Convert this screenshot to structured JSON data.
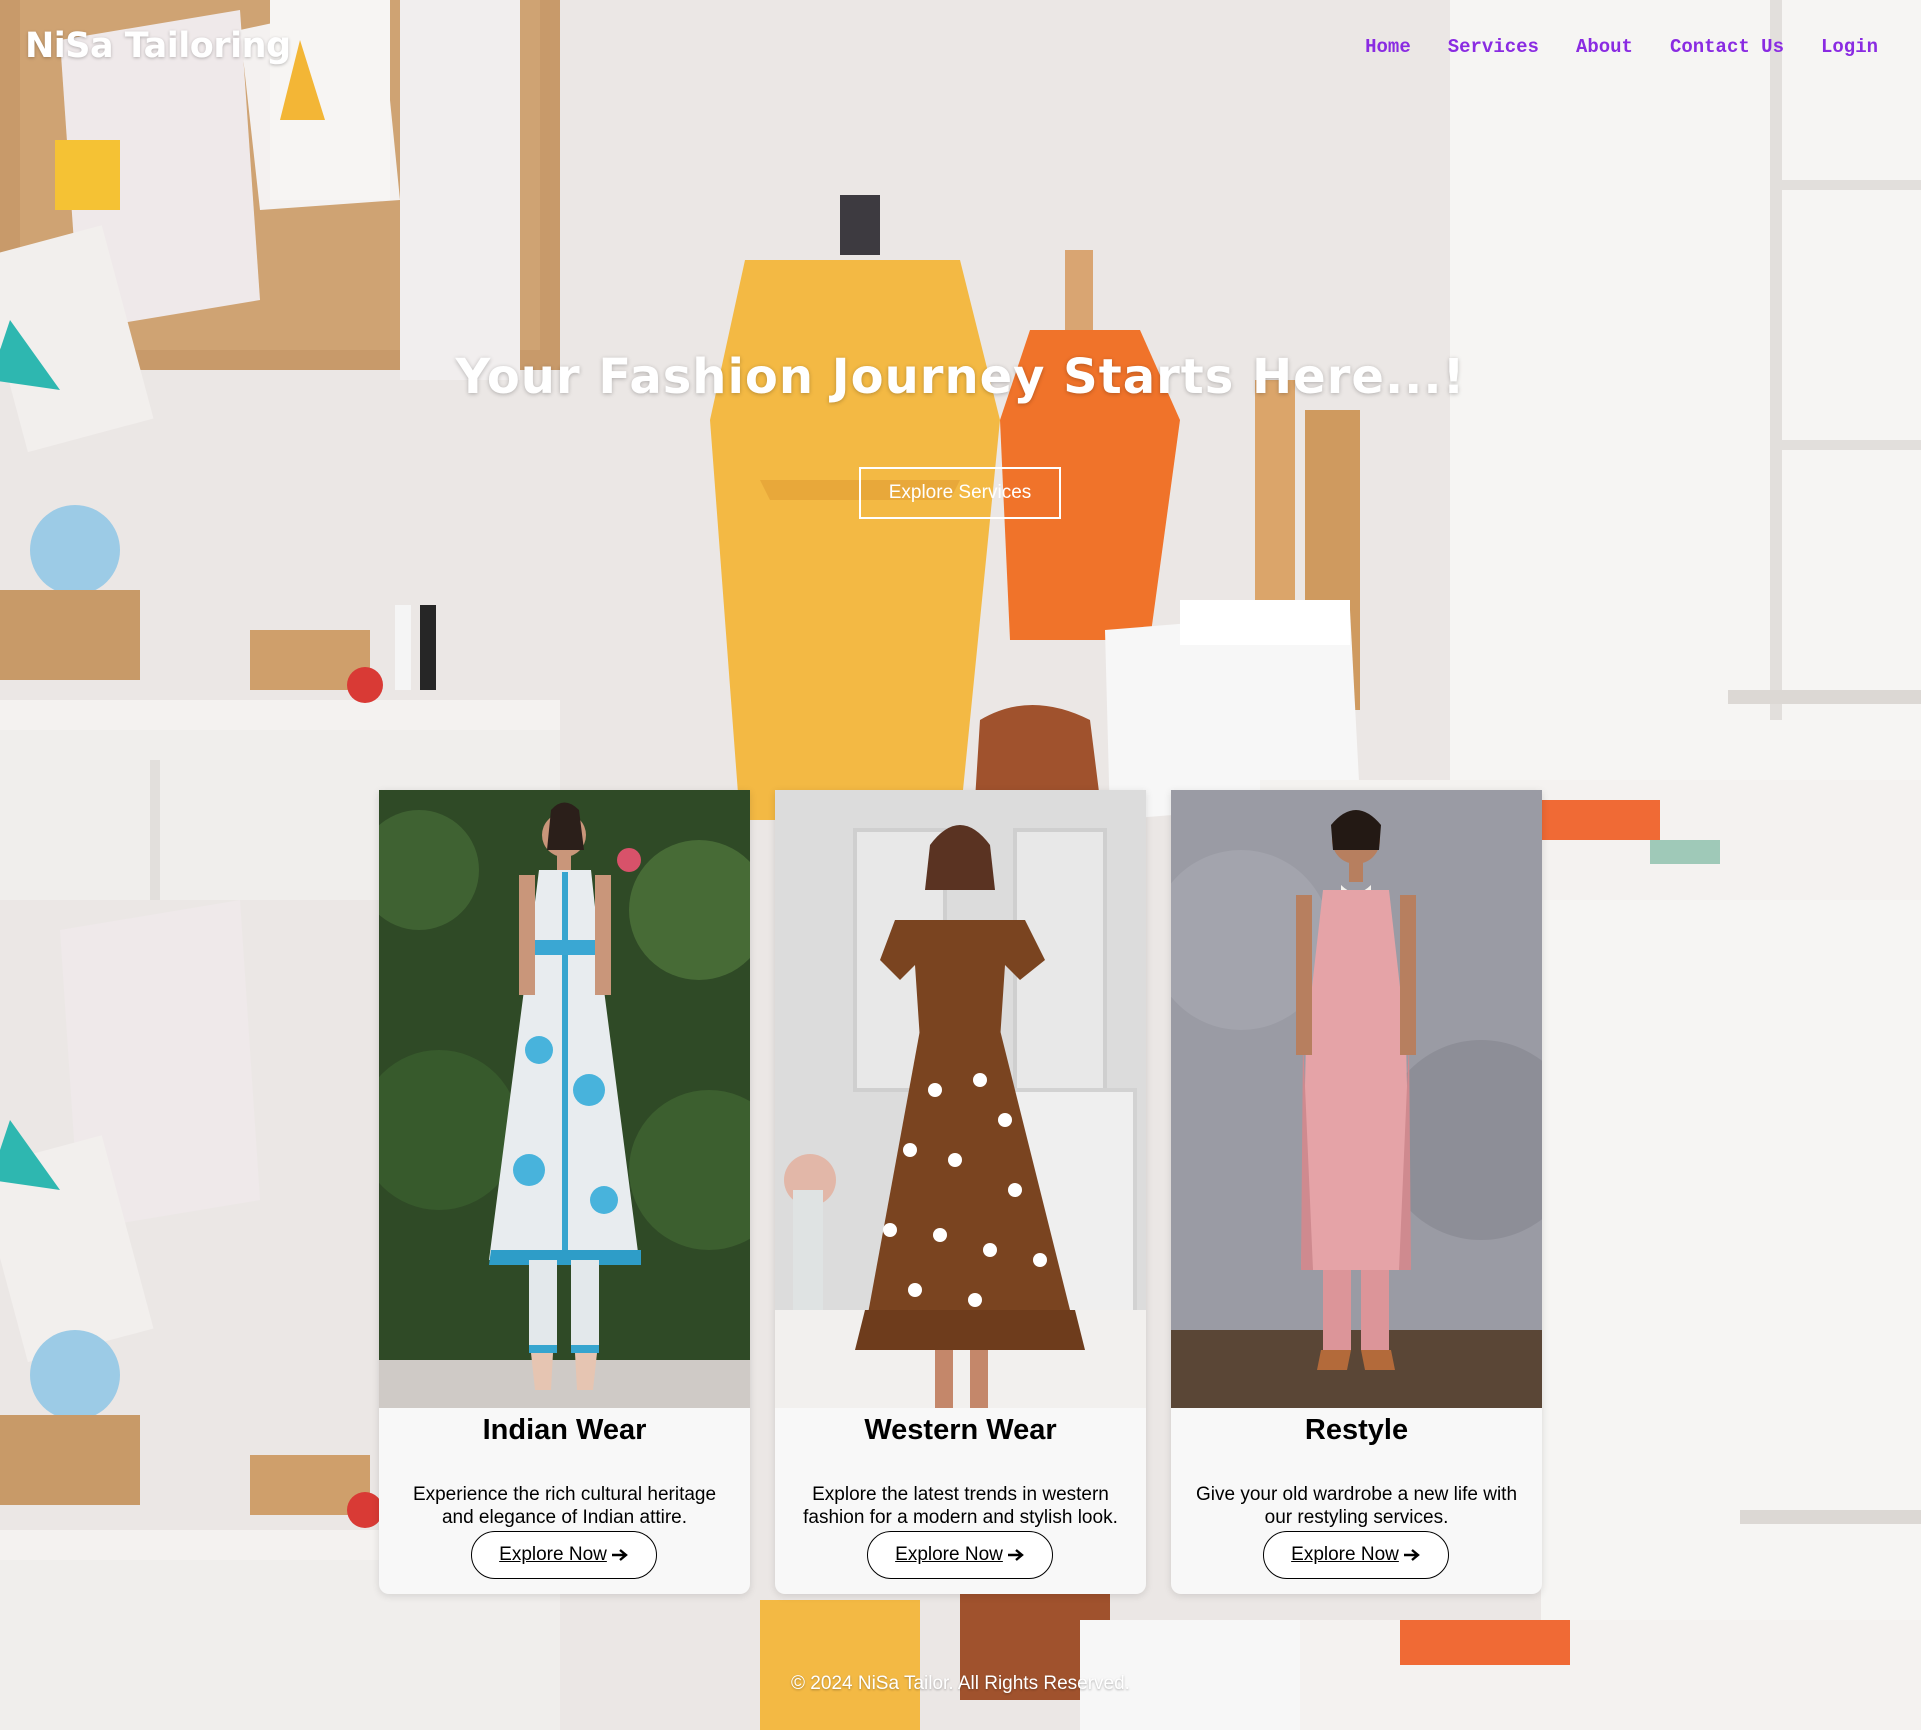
{
  "header": {
    "brand": "NiSa Tailoring",
    "nav": [
      {
        "label": "Home"
      },
      {
        "label": "Services"
      },
      {
        "label": "About"
      },
      {
        "label": "Contact Us"
      },
      {
        "label": "Login"
      }
    ],
    "nav_color": "#8a2be2"
  },
  "hero": {
    "title": "Your Fashion Journey Starts Here...!",
    "button_label": "Explore Services"
  },
  "cards": [
    {
      "title": "Indian Wear",
      "description": "Experience the rich cultural heritage and elegance of Indian attire.",
      "button_label": "Explore Now",
      "button_icon": "arrow-right-icon"
    },
    {
      "title": "Western Wear",
      "description": "Explore the latest trends in western fashion for a modern and stylish look.",
      "button_label": "Explore Now",
      "button_icon": "arrow-right-icon"
    },
    {
      "title": "Restyle",
      "description": "Give your old wardrobe a new life with our restyling services.",
      "button_label": "Explore Now",
      "button_icon": "arrow-right-icon"
    }
  ],
  "footer": {
    "text": "© 2024 NiSa Tailor. All Rights Reserved."
  }
}
